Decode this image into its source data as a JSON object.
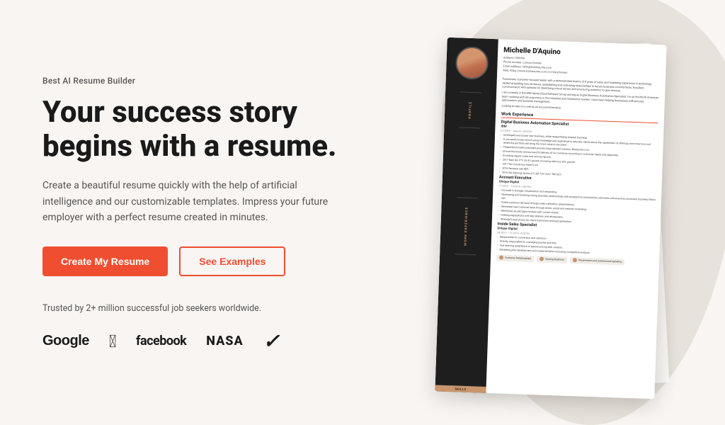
{
  "header": {
    "tagline": "Best AI Resume Builder"
  },
  "hero": {
    "headline_line1": "Your success story",
    "headline_line2": "begins with a resume.",
    "description": "Create a beautiful resume quickly with the help of artificial intelligence and our customizable templates. Impress your future employer with a perfect resume created in minutes.",
    "cta_primary": "Create My Resume",
    "cta_secondary": "See Examples"
  },
  "social_proof": {
    "trust_text": "Trusted by 2+ million successful job seekers worldwide.",
    "brands": [
      "Google",
      "Apple",
      "facebook",
      "NASA",
      "Nike"
    ]
  },
  "resume": {
    "name": "Michelle D'Aquino",
    "address": "Address: 909999",
    "phone": "Phone number: contact hidden",
    "email": "Email address: hello@kickresume.com",
    "web": "Web: https://www.kickresume.com/cv/mary-bowen",
    "profile_text": "Passionate, customer-focused leader with a demonstrated history of 8 years of sales and marketing experience in technology. Skilled at building new territories, establishing and cultivating relationships to secure business commitments. Excellent communicator, with aptitude for identifying critical drivers and structuring solutions to gain revenue.",
    "profile_text2": "I am currently in the IBM Hybrid Cloud Software Group serving as Digital Business Automation Specialist. I'm on the North American team, working with US customers in the Industrial and Distribution market. I have been helping businesses with process optimization and business management.",
    "profile_text3": "Looking to take on a role as an Account Executive.",
    "work_experience": [
      {
        "title": "Digital Business Automation Specialist",
        "company": "IBM",
        "dates": "01/2018 – present | AUSTIN",
        "bullets": [
          "Developed and closed new business, while renegotiating renewal business.",
          "A successful track-record using knowledge and experience to educate clients about the capabilities of offerings and know how and where the portfolio will bring the most value to the client.",
          "Presented and demonstrated process Improvement solution, Blueworks Live.",
          "Ensure the timely and successful delivery of our solutions according to customer needs and objectives.",
          "Providing regular sales and activity reports.",
          "2017 New NA YTY 24.4% growth, including Add-Ons 52% growth",
          "2017 NA Conversion Rate10.4%",
          "2016 Renewal rate 88%",
          "2016 NA Signings Quota of 2.2M TCV and 1.9M ACV"
        ]
      },
      {
        "title": "Account Executive",
        "company": "Unique Digital",
        "dates": "11/2014 – 10/2018 | AUSTIN",
        "bullets": [
          "Focused in storage, virtualization and networking",
          "Developing and fostering strong business relationships with prospective and existing customers and ensuring consistent business follow ups.",
          "Create solutions demand through sales calibration presentations.",
          "Generated new customer base through direct, social and network marketing.",
          "Identifying up-sell opportunities with current clients.",
          "Holding negotiations with key retailers and wholesalers.",
          "Attended trade shows for client interaction and lead generation."
        ]
      },
      {
        "title": "Inside Sales Specialist",
        "company": "Unique Digital",
        "dates": "08/2013 – 01/2015 | AUSTIN",
        "bullets": [
          "Responsible for conversion and retention.",
          "Directly responsible for managing quotes and bids.",
          "Fast learning experience of special pricing with vendors.",
          "Marketing plan development and implementation including competitive analysis."
        ]
      }
    ],
    "skills": [
      "Customer Relationships",
      "Closing Business",
      "Presentation and professional speaking"
    ]
  }
}
